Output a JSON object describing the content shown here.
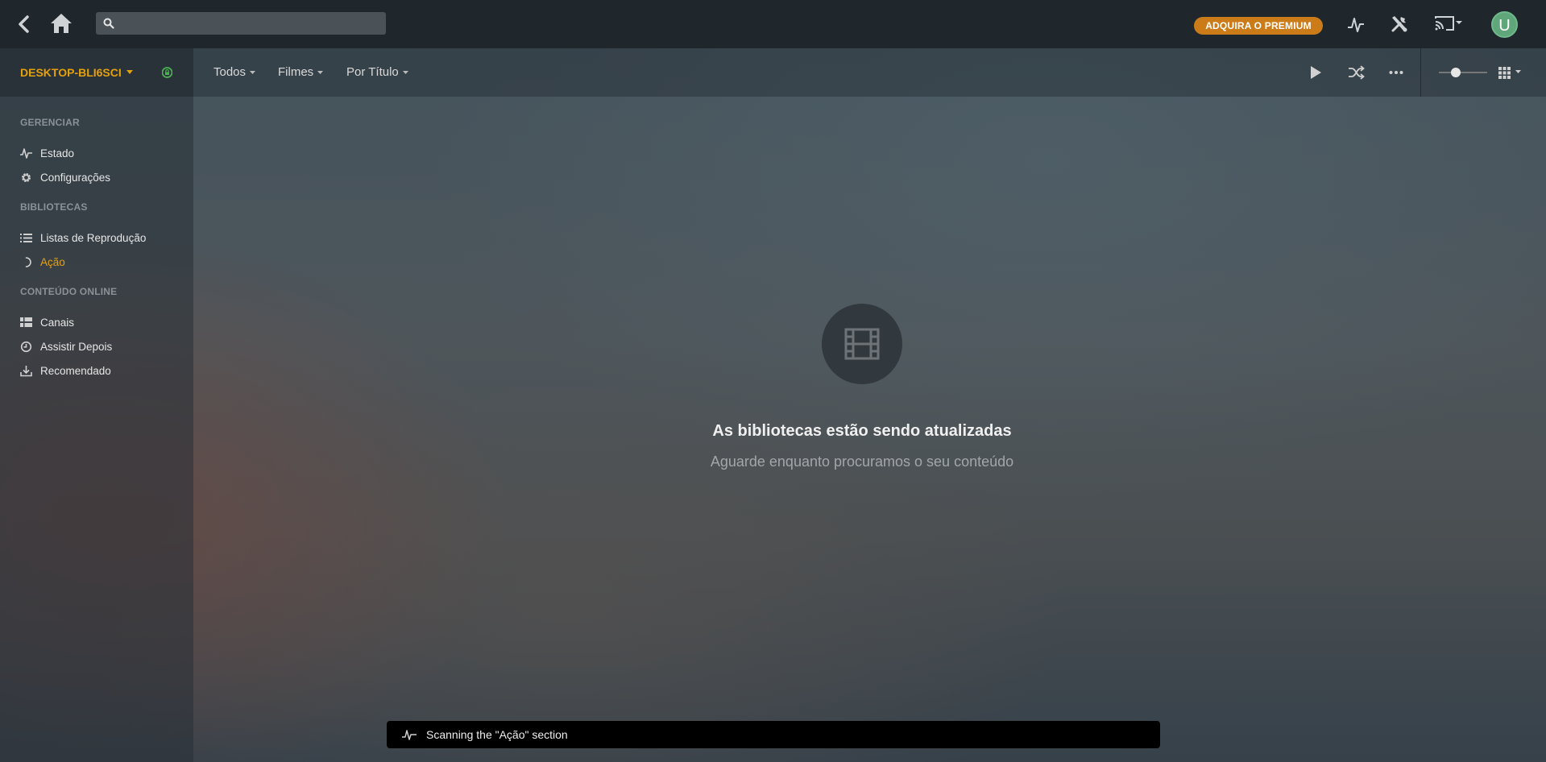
{
  "topbar": {
    "search": {
      "value": "",
      "placeholder": ""
    },
    "premium_label": "ADQUIRA O PREMIUM",
    "avatar_letter": "U"
  },
  "sidebar": {
    "server_name": "DESKTOP-BLI6SCI",
    "sections": {
      "manage": "GERENCIAR",
      "libraries": "BIBLIOTECAS",
      "online": "CONTEÚDO ONLINE"
    },
    "items": {
      "status": "Estado",
      "settings": "Configurações",
      "playlists": "Listas de Reprodução",
      "acao": "Ação",
      "channels": "Canais",
      "watch_later": "Assistir Depois",
      "recommended": "Recomendado"
    }
  },
  "libbar": {
    "filters": {
      "all": "Todos",
      "type": "Filmes",
      "sort": "Por Título"
    }
  },
  "empty_state": {
    "title": "As bibliotecas estão sendo atualizadas",
    "subtitle": "Aguarde enquanto procuramos o seu conteúdo"
  },
  "toast": {
    "message": "Scanning the \"Ação\" section"
  },
  "colors": {
    "accent": "#e5a00d",
    "premium": "#cc7b19",
    "avatar": "#5fa77a"
  }
}
